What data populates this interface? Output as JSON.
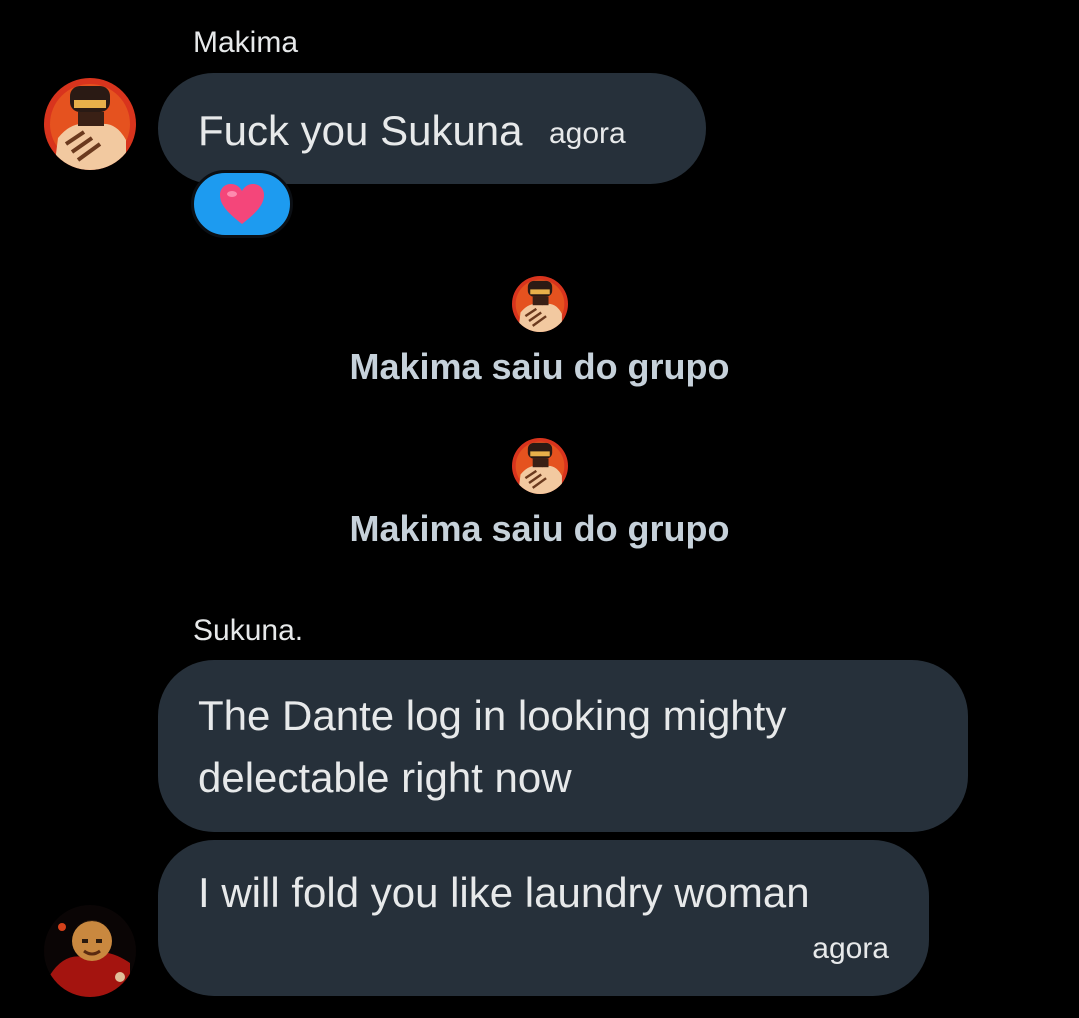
{
  "messages": {
    "first_group": {
      "sender": "Makima",
      "text": "Fuck you Sukuna",
      "time": "agora",
      "reaction": "heart-icon"
    },
    "system_events": [
      {
        "text": "Makima saiu do grupo",
        "avatar": "makima-avatar"
      },
      {
        "text": "Makima saiu do grupo",
        "avatar": "makima-avatar"
      }
    ],
    "second_group": {
      "sender": "Sukuna.",
      "message_1_line_1": "The Dante log in looking mighty",
      "message_1_line_2": "delectable right now",
      "message_2": "I will fold you like laundry woman",
      "time": "agora"
    }
  },
  "colors": {
    "background": "#000000",
    "bubble": "#26303a",
    "text": "#e7e9ea",
    "system_text": "#c6d1da",
    "reaction_bg": "#1d9bf0",
    "heart": "#f4467a"
  }
}
